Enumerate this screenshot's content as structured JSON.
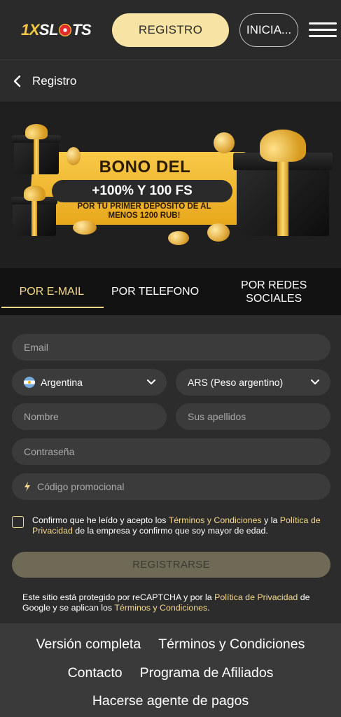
{
  "header": {
    "logo": {
      "part1": "1X",
      "part2": "SL",
      "part3": "TS"
    },
    "register_button": "REGISTRO",
    "login_button": "INICIA..."
  },
  "backbar": {
    "title": "Registro"
  },
  "banner": {
    "title": "BONO DEL",
    "highlight": "+100% Y 100 FS",
    "subtitle": "POR TU PRIMER DEPÓSITO DE AL MENOS 1200 RUB!"
  },
  "tabs": [
    {
      "label": "POR E-MAIL",
      "active": true
    },
    {
      "label": "POR TELEFONO",
      "active": false
    },
    {
      "label": "POR REDES SOCIALES",
      "active": false
    }
  ],
  "form": {
    "email_placeholder": "Email",
    "country": "Argentina",
    "currency": "ARS (Peso argentino)",
    "name_placeholder": "Nombre",
    "surname_placeholder": "Sus apellidos",
    "password_placeholder": "Contraseña",
    "promo_placeholder": "Código promocional",
    "consent": {
      "text1": "Confirmo que he leído y acepto los ",
      "link1": "Términos y Condiciones",
      "text2": " y la ",
      "link2": "Política de Privacidad",
      "text3": " de la empresa y confirmo que soy mayor de edad."
    },
    "submit_label": "REGISTRARSE",
    "recaptcha": {
      "text1": "Este sitio está protegido por reCAPTCHA y por la ",
      "link1": "Política de Privacidad",
      "text2": " de Google y se aplican los ",
      "link2": "Términos y Condiciones",
      "text3": "."
    }
  },
  "footer": {
    "links": [
      "Versión completa",
      "Términos y Condiciones",
      "Contacto",
      "Programa de Afiliados",
      "Hacerse agente de pagos"
    ]
  },
  "colors": {
    "accent": "#f7d98b",
    "button_bg": "#f7e4a4",
    "background": "#2c2c2c",
    "field_bg": "#3b3b3b"
  }
}
